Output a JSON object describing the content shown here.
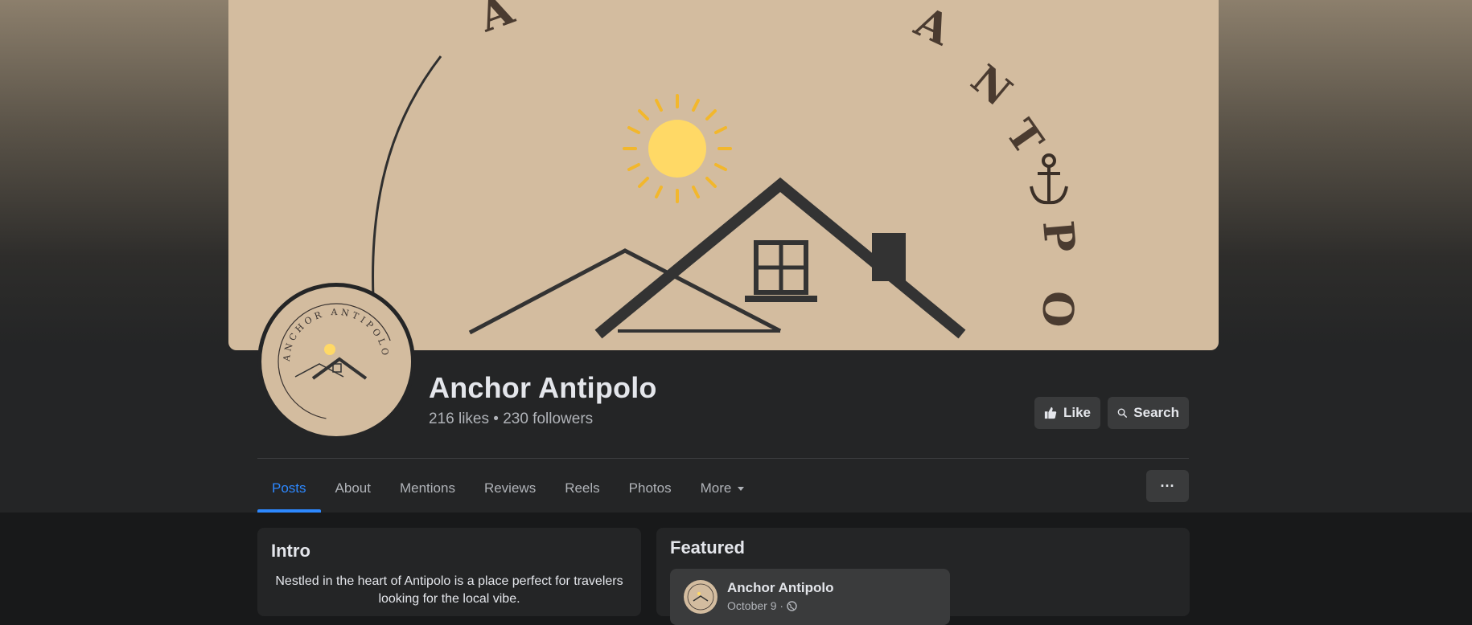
{
  "page": {
    "name": "Anchor Antipolo",
    "stats": "216 likes • 230 followers",
    "cover_text": [
      "A",
      "A",
      "N",
      "T",
      "P",
      "O"
    ]
  },
  "actions": {
    "like_label": "Like",
    "search_label": "Search",
    "more_options_label": "···"
  },
  "tabs": [
    {
      "label": "Posts",
      "active": true
    },
    {
      "label": "About"
    },
    {
      "label": "Mentions"
    },
    {
      "label": "Reviews"
    },
    {
      "label": "Reels"
    },
    {
      "label": "Photos"
    },
    {
      "label": "More"
    }
  ],
  "intro": {
    "title": "Intro",
    "bio": "Nestled in the heart of Antipolo is a place perfect for travelers looking for the local vibe."
  },
  "featured": {
    "title": "Featured",
    "post_author": "Anchor Antipolo",
    "post_date": "October 9 ·"
  },
  "logo": {
    "text": "ANCHOR ANTIPOLO"
  },
  "colors": {
    "accent": "#2d88ff",
    "background": "#18191a",
    "surface": "#242526",
    "button": "#3a3b3c",
    "cover": "#d3bc9f",
    "sun": "#ffd966"
  },
  "icons": [
    "thumbs-up-icon",
    "search-icon",
    "caret-down-icon",
    "ellipsis-icon",
    "globe-icon",
    "anchor-icon",
    "sun-icon",
    "house-icon"
  ]
}
